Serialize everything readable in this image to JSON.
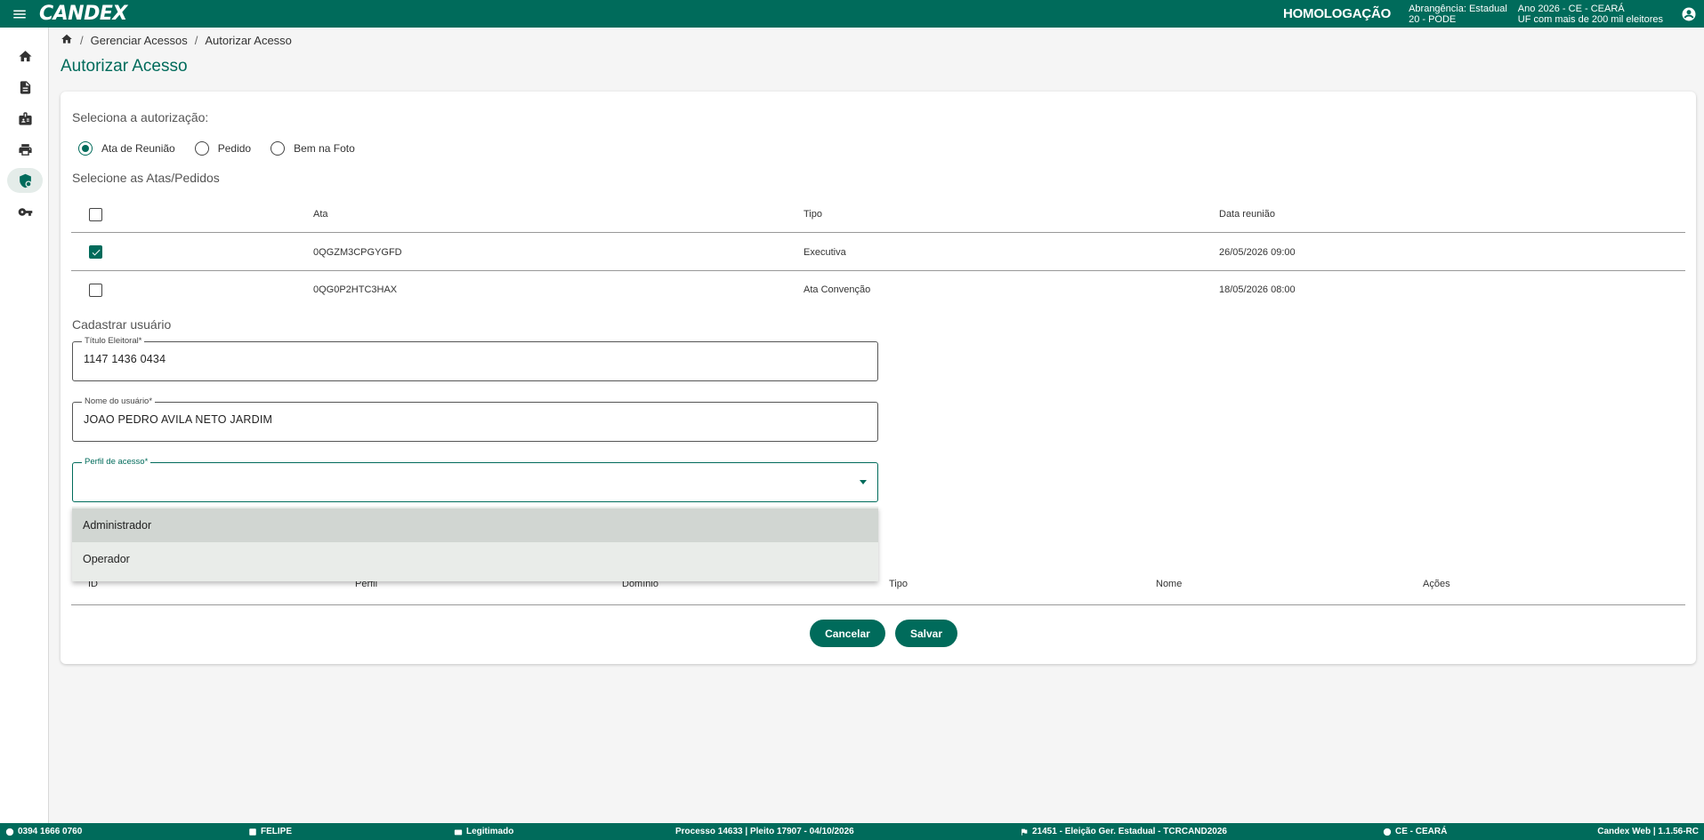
{
  "header": {
    "logo": "CANDEX",
    "environment": "HOMOLOGAÇÃO",
    "scope_line1": "Abrangência: Estadual",
    "scope_line2": "20 - PODE",
    "year_line1": "Ano 2026 - CE - CEARÁ",
    "year_line2": "UF com mais de 200 mil eleitores"
  },
  "sidebar": {
    "items": [
      {
        "icon": "home-icon"
      },
      {
        "icon": "document-icon"
      },
      {
        "icon": "id-badge-icon"
      },
      {
        "icon": "print-icon"
      },
      {
        "icon": "security-shield-icon",
        "active": true
      },
      {
        "icon": "key-icon"
      }
    ]
  },
  "breadcrumb": {
    "items": [
      "Gerenciar Acessos",
      "Autorizar Acesso"
    ]
  },
  "page": {
    "title": "Autorizar Acesso"
  },
  "form": {
    "select_auth_label": "Seleciona a autorização:",
    "radio_options": [
      {
        "label": "Ata de Reunião",
        "selected": true
      },
      {
        "label": "Pedido",
        "selected": false
      },
      {
        "label": "Bem na Foto",
        "selected": false
      }
    ],
    "atas_label": "Selecione as Atas/Pedidos",
    "atas_table": {
      "columns": [
        "Ata",
        "Tipo",
        "Data reunião"
      ],
      "rows": [
        {
          "checked": true,
          "ata": "0QGZM3CPGYGFD",
          "tipo": "Executiva",
          "data": "26/05/2026 09:00"
        },
        {
          "checked": false,
          "ata": "0QG0P2HTC3HAX",
          "tipo": "Ata Convenção",
          "data": "18/05/2026 08:00"
        }
      ]
    },
    "register_label": "Cadastrar usuário",
    "titulo_field": {
      "label": "Título Eleitoral",
      "value": "1147 1436 0434"
    },
    "nome_field": {
      "label": "Nome do usuário",
      "value": "JOAO PEDRO AVILA NETO JARDIM"
    },
    "perfil_field": {
      "label": "Perfil de acesso",
      "value": ""
    },
    "perfil_options": [
      "Administrador",
      "Operador"
    ],
    "profiles_table": {
      "columns": [
        "ID",
        "Perfil",
        "Domínio",
        "Tipo",
        "Nome",
        "Ações"
      ]
    },
    "cancel_label": "Cancelar",
    "save_label": "Salvar"
  },
  "footer": {
    "titulo": "0394 1666 0760",
    "user": "FELIPE",
    "status": "Legitimado",
    "processo": "Processo 14633 | Pleito 17907 - 04/10/2026",
    "eleicao": "21451 - Eleição Ger. Estadual - TCRCAND2026",
    "uf": "CE - CEARÁ",
    "version": "Candex Web | 1.1.56-RC"
  },
  "colors": {
    "primary": "#006b5b",
    "background": "#f5f5f5",
    "dropdown_bg": "#e9ece9",
    "dropdown_hover": "#d1d6d2"
  }
}
